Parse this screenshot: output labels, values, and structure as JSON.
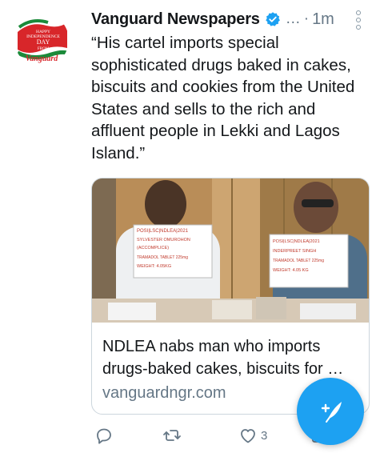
{
  "avatar": {
    "badge_line1": "HAPPY",
    "badge_line2": "INDEPENDENCE",
    "badge_line3": "DAY",
    "badge_line4": "FROM",
    "brand": "Vanguard",
    "colors": {
      "red": "#d8262a",
      "green": "#1b8a3a"
    }
  },
  "tweet": {
    "author": "Vanguard Newspapers",
    "handle_truncated": "…",
    "separator": "·",
    "time": "1m",
    "text": "“His cartel imports special sophisticated drugs baked in cakes, biscuits and cookies from the United States and sells to the rich and affluent people in Lekki and Lagos Island.”"
  },
  "card": {
    "title": "NDLEA nabs man who imports drugs-baked cakes, biscuits for …",
    "domain": "vanguardngr.com",
    "sign_left": [
      "POSI|LSC|NDLEA|2021",
      "SYLVESTER OMUROHON",
      "(ACCOMPLICE)",
      "TRAMADOL TABLET 225mg",
      "WEIGHT: 4.05KG"
    ],
    "sign_right": [
      "POSI|LSC|NDLEA|2021",
      "INDERPREET SINGH",
      "TRAMADOL TABLET 225mg",
      "WEIGHT: 4.05 KG"
    ]
  },
  "actions": {
    "reply": {
      "icon": "reply-icon",
      "count": ""
    },
    "retweet": {
      "icon": "retweet-icon",
      "count": ""
    },
    "like": {
      "icon": "heart-icon",
      "count": "3"
    },
    "share": {
      "icon": "share-icon",
      "count": ""
    }
  },
  "colors": {
    "accent": "#1da1f2",
    "muted": "#657786",
    "text": "#14171a",
    "border": "#ccd6dd"
  }
}
